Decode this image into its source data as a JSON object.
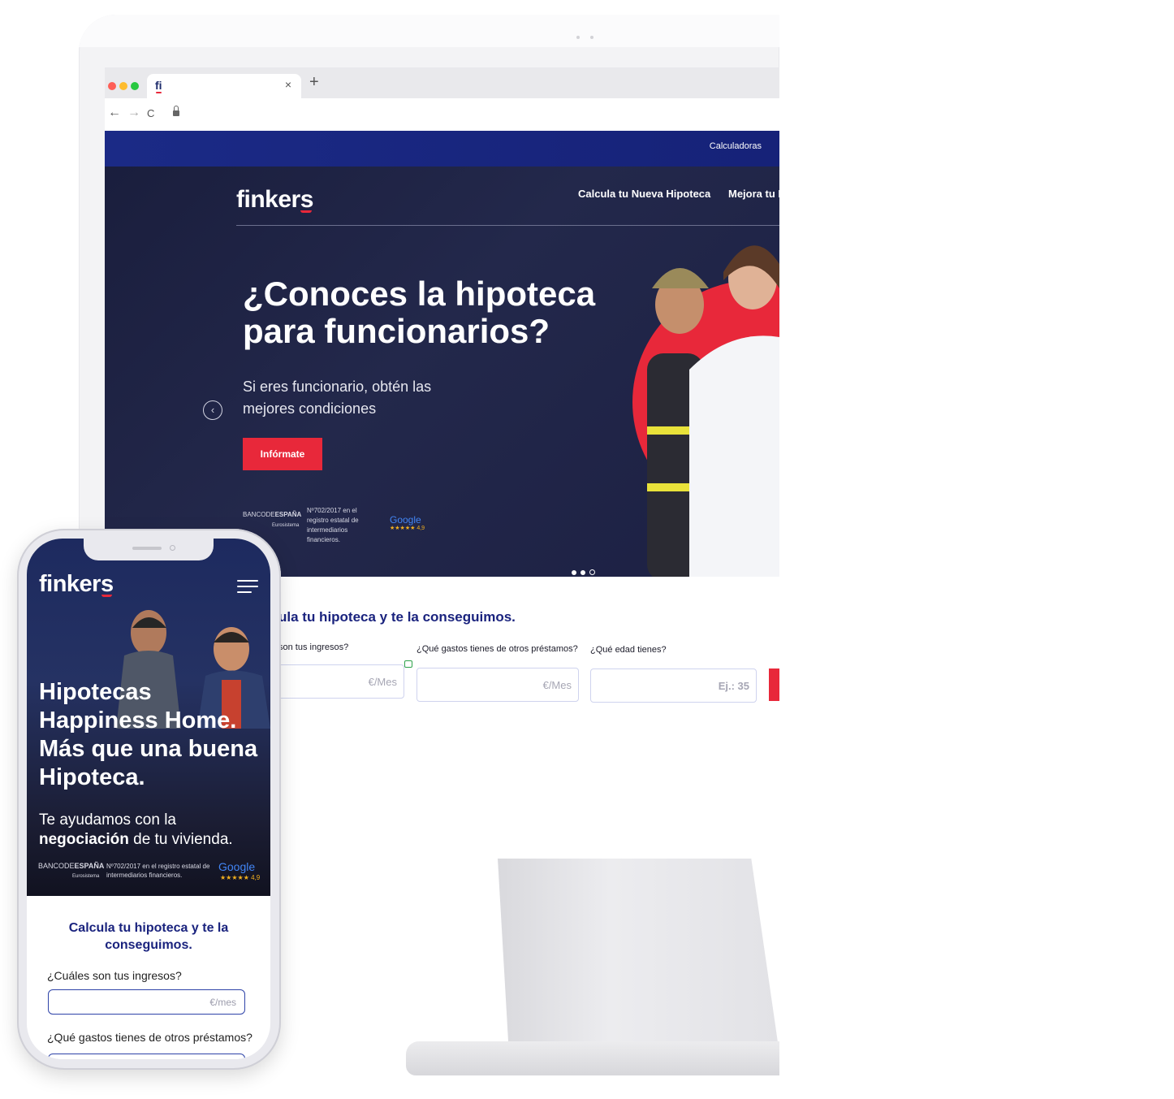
{
  "browser": {
    "tab_favicon": "fi",
    "close_glyph": "×",
    "new_tab_glyph": "+",
    "back_glyph": "←",
    "forward_glyph": "→",
    "reload_glyph": "C"
  },
  "desktop": {
    "topbar_link": "Calculadoras",
    "logo": "finkers",
    "nav": [
      "Calcula tu Nueva Hipoteca",
      "Mejora tu Hi"
    ],
    "hero": {
      "title": "¿Conoces la hipoteca para funcionarios?",
      "subtitle": "Si eres funcionario, obtén las mejores condiciones",
      "prev_glyph": "‹",
      "cta": "Infórmate"
    },
    "trust": {
      "bank_prefix": "BANCODE",
      "bank_name": "ESPAÑA",
      "bank_sub": "Eurosistema",
      "registry": "Nº702/2017 en el registro estatal de intermediarios financieros.",
      "google": "Google",
      "rating": "★★★★★ 4,9"
    },
    "calculator": {
      "title": "ula tu hipoteca y te la conseguimos.",
      "fields": [
        {
          "label": "son tus ingresos?",
          "placeholder": "€/Mes"
        },
        {
          "label": "¿Qué gastos tienes de otros préstamos?",
          "placeholder": "€/Mes"
        },
        {
          "label": "¿Qué edad tienes?",
          "placeholder": "Ej.: 35"
        }
      ]
    }
  },
  "mobile": {
    "logo": "finkers",
    "hero": {
      "title": "Hipotecas Happiness Home. Más que una buena Hipoteca.",
      "subtitle_pre": "Te ayudamos con la",
      "subtitle_bold": "negociación",
      "subtitle_post": "de tu vivienda."
    },
    "trust": {
      "bank_prefix": "BANCODE",
      "bank_name": "ESPAÑA",
      "bank_sub": "Eurosistema",
      "registry": "Nº702/2017 en el registro estatal de intermediarios financieros.",
      "google": "Google",
      "rating": "★★★★★ 4,9"
    },
    "calculator": {
      "title": "Calcula tu hipoteca y te la conseguimos.",
      "fields": [
        {
          "label": "¿Cuáles son tus ingresos?",
          "placeholder": "€/mes"
        },
        {
          "label": "¿Qué gastos tienes de otros préstamos?",
          "placeholder": ""
        }
      ]
    }
  },
  "colors": {
    "brand_navy": "#1a237e",
    "brand_red": "#e8283a",
    "hero_dark": "#1f2445",
    "top_strip": "#1b2a86"
  }
}
